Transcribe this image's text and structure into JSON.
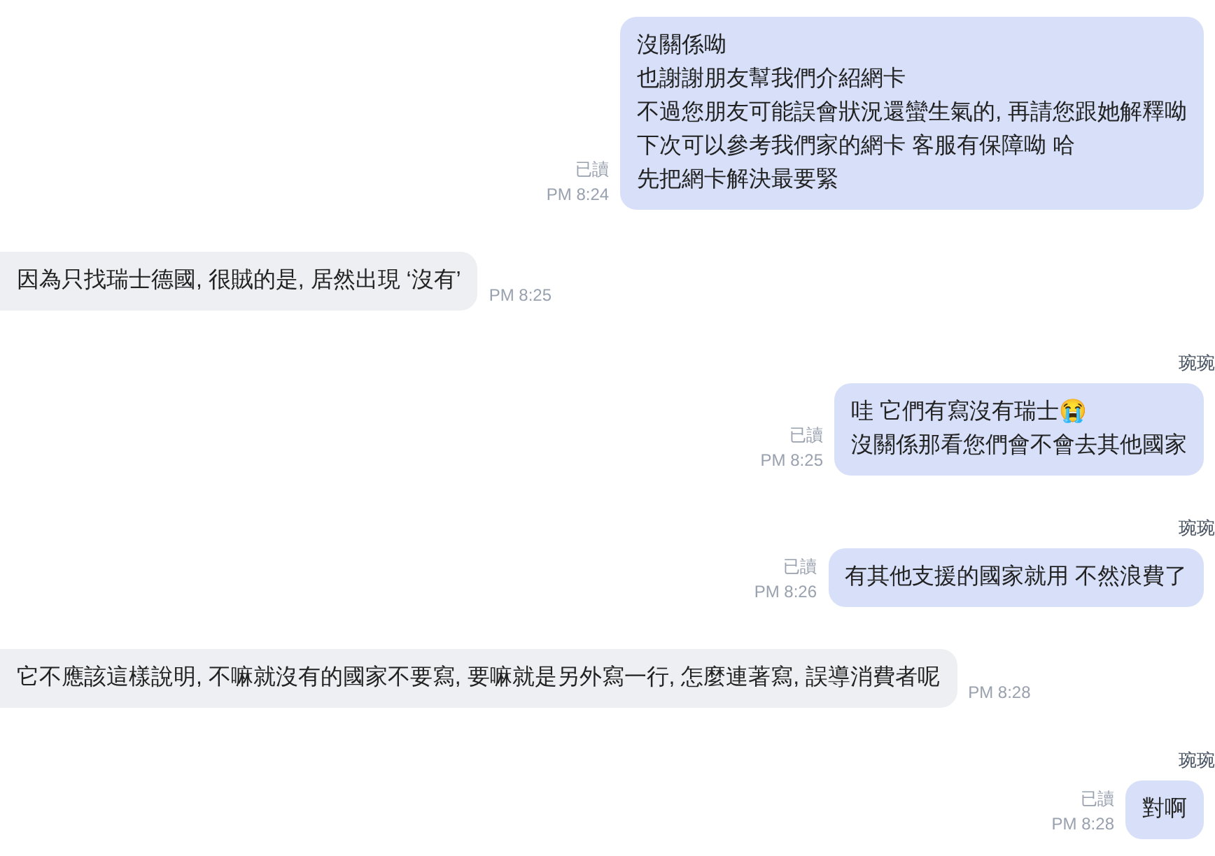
{
  "messages": [
    {
      "kind": "outgoing",
      "lines": [
        "沒關係呦",
        "也謝謝朋友幫我們介紹網卡",
        "不過您朋友可能誤會狀況還蠻生氣的, 再請您跟她解釋呦",
        "下次可以參考我們家的網卡 客服有保障呦 哈",
        "先把網卡解決最要緊"
      ],
      "read": "已讀",
      "time": "PM 8:24"
    },
    {
      "kind": "incoming",
      "lines": [
        "因為只找瑞士德國, 很賊的是, 居然出現 ‘沒有’"
      ],
      "time": "PM 8:25"
    },
    {
      "kind": "outgoing",
      "sender": "琬琬",
      "lines": [
        "哇 它們有寫沒有瑞士😭",
        "沒關係那看您們會不會去其他國家"
      ],
      "read": "已讀",
      "time": "PM 8:25"
    },
    {
      "kind": "outgoing",
      "sender": "琬琬",
      "lines": [
        "有其他支援的國家就用 不然浪費了"
      ],
      "read": "已讀",
      "time": "PM 8:26"
    },
    {
      "kind": "incoming",
      "lines": [
        "它不應該這樣說明, 不嘛就沒有的國家不要寫, 要嘛就是另外寫一行, 怎麼連著寫, 誤導消費者呢"
      ],
      "time": "PM 8:28"
    },
    {
      "kind": "outgoing",
      "sender": "琬琬",
      "lines": [
        "對啊"
      ],
      "read": "已讀",
      "time": "PM 8:28"
    }
  ]
}
